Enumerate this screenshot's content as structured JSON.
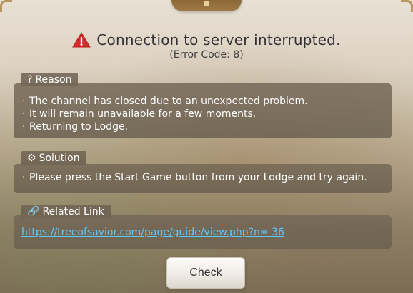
{
  "dialog": {
    "title": "Connection to server interrupted.",
    "error_code": "(Error Code: 8)",
    "warning_color": "#d62b2b"
  },
  "sections": {
    "reason": {
      "label": "Reason",
      "icon": "question-mark",
      "lines": [
        "The channel has closed due to an unexpected problem.",
        "It will remain unavailable for a few moments.",
        "Returning to Lodge."
      ]
    },
    "solution": {
      "label": "Solution",
      "icon": "gear",
      "text": "Please press the Start Game button from your Lodge and try again."
    },
    "related_link": {
      "label": "Related Link",
      "icon": "chain-link",
      "url": "https://treeofsavior.com/page/guide/view.php?n= 36"
    }
  },
  "buttons": {
    "check": "Check"
  },
  "colors": {
    "panel_bg": "#716654",
    "link": "#5ec8ff",
    "title_text": "#333333"
  }
}
